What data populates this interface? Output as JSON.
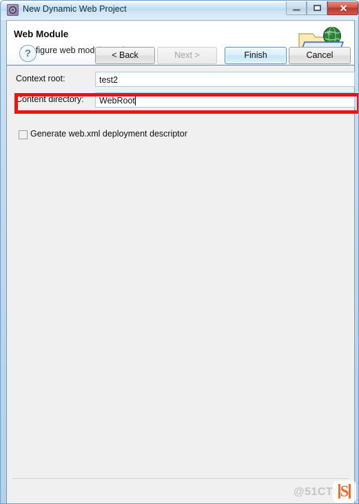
{
  "window": {
    "title": "New Dynamic Web Project",
    "app_icon": "gear-icon",
    "controls": {
      "minimize_label": "–",
      "maximize_label": "□",
      "close_label": "✕"
    }
  },
  "header": {
    "title": "Web Module",
    "description": "Configure web module settings.",
    "banner_icon": "folder-globe-icon"
  },
  "form": {
    "context_root": {
      "label": "Context root:",
      "value": "test2",
      "placeholder": ""
    },
    "content_directory": {
      "label": "Content directory:",
      "value": "WebRoot",
      "placeholder": ""
    },
    "generate_webxml": {
      "label": "Generate web.xml deployment descriptor",
      "checked": false
    }
  },
  "annotation": {
    "highlight_color": "#ee1111",
    "highlight_target": "content-directory-row"
  },
  "footer": {
    "help_label": "?",
    "back_label": "< Back",
    "next_label": "Next >",
    "finish_label": "Finish",
    "cancel_label": "Cancel"
  },
  "watermark": {
    "text": "@51CTO",
    "logo_letter": "S"
  },
  "colors": {
    "accent": "#3c94d0",
    "titlebar": "#bcd9f0",
    "close_button": "#b9392c",
    "highlight": "#ee1111",
    "watermark_orange": "#e8702a"
  }
}
